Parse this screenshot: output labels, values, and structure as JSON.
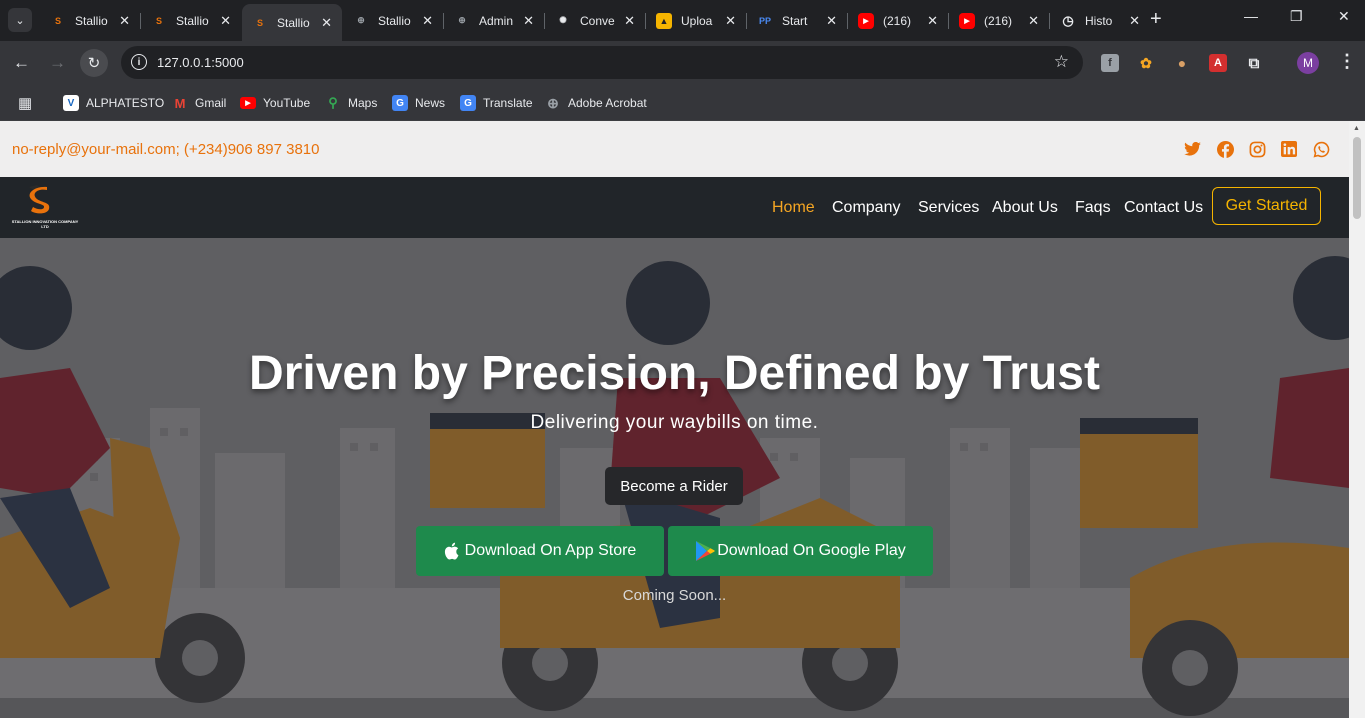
{
  "tabs": [
    {
      "label": "Stallio",
      "fav_color": "#e8720c",
      "fav_glyph": "S"
    },
    {
      "label": "Stallio",
      "fav_color": "#e8720c",
      "fav_glyph": "S"
    },
    {
      "label": "Stallio",
      "fav_color": "#e8720c",
      "fav_glyph": "S"
    },
    {
      "label": "Stallio",
      "fav_color": "#9aa0a6",
      "fav_glyph": "⊕"
    },
    {
      "label": "Admin",
      "fav_color": "#9aa0a6",
      "fav_glyph": "⊕"
    },
    {
      "label": "Conve",
      "fav_color": "#e8eaed",
      "fav_glyph": "✺"
    },
    {
      "label": "Uploa",
      "fav_color": "#f5b400",
      "fav_glyph": "▲"
    },
    {
      "label": "Start",
      "fav_color": "#4a8af4",
      "fav_glyph": "PP"
    },
    {
      "label": "(216)",
      "fav_color": "#ff0000",
      "fav_glyph": "▶"
    },
    {
      "label": "(216)",
      "fav_color": "#ff0000",
      "fav_glyph": "▶"
    },
    {
      "label": "Histo",
      "fav_color": "#e8eaed",
      "fav_glyph": "◷"
    }
  ],
  "active_tab_index": 2,
  "omnibox": {
    "url": "127.0.0.1:5000"
  },
  "bookmarks": [
    {
      "label": "ALPHATESTO",
      "icon": "v-icon",
      "color": "#1565c0",
      "glyph": "V"
    },
    {
      "label": "Gmail",
      "icon": "gmail-icon",
      "color": "#ea4335",
      "glyph": "M"
    },
    {
      "label": "YouTube",
      "icon": "youtube-icon",
      "color": "#ff0000",
      "glyph": "▶"
    },
    {
      "label": "Maps",
      "icon": "maps-icon",
      "color": "#34a853",
      "glyph": "⬤"
    },
    {
      "label": "News",
      "icon": "news-icon",
      "color": "#4285f4",
      "glyph": "G"
    },
    {
      "label": "Translate",
      "icon": "translate-icon",
      "color": "#4285f4",
      "glyph": "G"
    },
    {
      "label": "Adobe Acrobat",
      "icon": "globe-icon",
      "color": "#9aa0a6",
      "glyph": "⊕"
    }
  ],
  "site": {
    "contact": "no-reply@your-mail.com; (+234)906 897 3810",
    "logo_text": "STALLION INNOVATION COMPANY LTD",
    "nav": [
      "Home",
      "Company",
      "Services",
      "About Us",
      "Faqs",
      "Contact Us"
    ],
    "cta": "Get Started",
    "accent": "#e8720c",
    "social": [
      "twitter-icon",
      "facebook-icon",
      "instagram-icon",
      "linkedin-icon",
      "whatsapp-icon"
    ]
  },
  "hero": {
    "title": "Driven by Precision, Defined by Trust",
    "subtitle": "Delivering your waybills on time.",
    "rider_button": "Become a Rider",
    "app_store_button": "Download On App Store",
    "google_play_button": "Download On Google Play",
    "coming_soon": "Coming Soon..."
  }
}
